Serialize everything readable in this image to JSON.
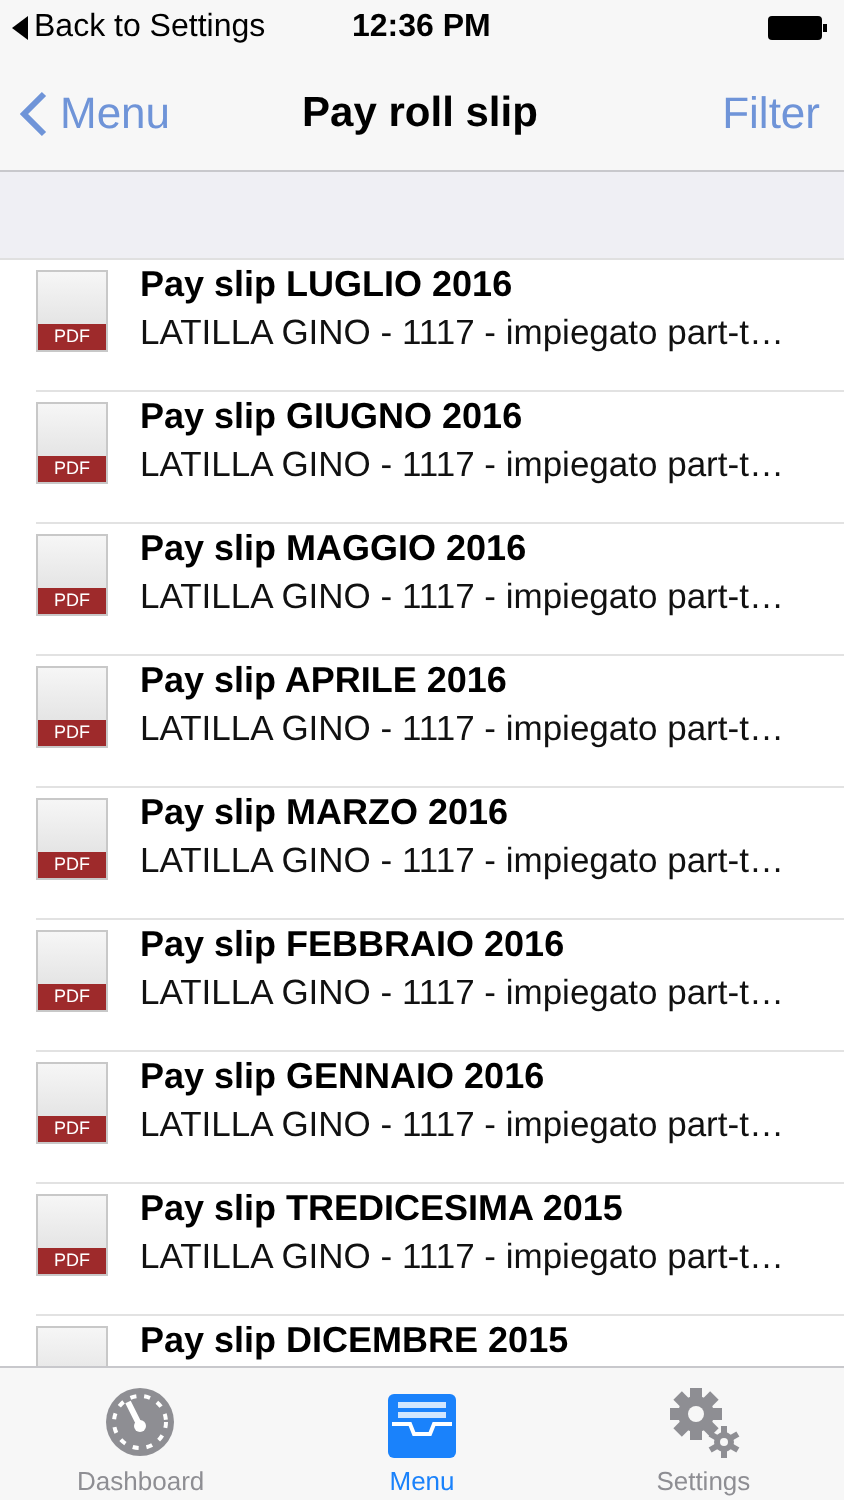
{
  "status_bar": {
    "back": "Back to Settings",
    "time": "12:36 PM"
  },
  "nav": {
    "back": "Menu",
    "title": "Pay roll slip",
    "action": "Filter"
  },
  "slips": [
    {
      "badge": "PDF",
      "title": "Pay slip LUGLIO 2016",
      "subtitle": "LATILLA GINO - 1117 - impiegato part-t…"
    },
    {
      "badge": "PDF",
      "title": "Pay slip GIUGNO 2016",
      "subtitle": "LATILLA GINO - 1117 - impiegato part-t…"
    },
    {
      "badge": "PDF",
      "title": "Pay slip MAGGIO 2016",
      "subtitle": "LATILLA GINO - 1117 - impiegato part-t…"
    },
    {
      "badge": "PDF",
      "title": "Pay slip APRILE 2016",
      "subtitle": "LATILLA GINO - 1117 - impiegato part-t…"
    },
    {
      "badge": "PDF",
      "title": "Pay slip MARZO 2016",
      "subtitle": "LATILLA GINO - 1117 - impiegato part-t…"
    },
    {
      "badge": "PDF",
      "title": "Pay slip FEBBRAIO 2016",
      "subtitle": "LATILLA GINO - 1117 - impiegato part-t…"
    },
    {
      "badge": "PDF",
      "title": "Pay slip GENNAIO 2016",
      "subtitle": "LATILLA GINO - 1117 - impiegato part-t…"
    },
    {
      "badge": "PDF",
      "title": "Pay slip TREDICESIMA 2015",
      "subtitle": "LATILLA GINO - 1117 - impiegato part-t…"
    },
    {
      "title": "Pay slip DICEMBRE 2015"
    }
  ],
  "tabs": [
    {
      "kind": "dashboard",
      "label": "Dashboard",
      "selected": false
    },
    {
      "kind": "menu",
      "label": "Menu",
      "selected": true
    },
    {
      "kind": "settings",
      "label": "Settings",
      "selected": false
    }
  ]
}
